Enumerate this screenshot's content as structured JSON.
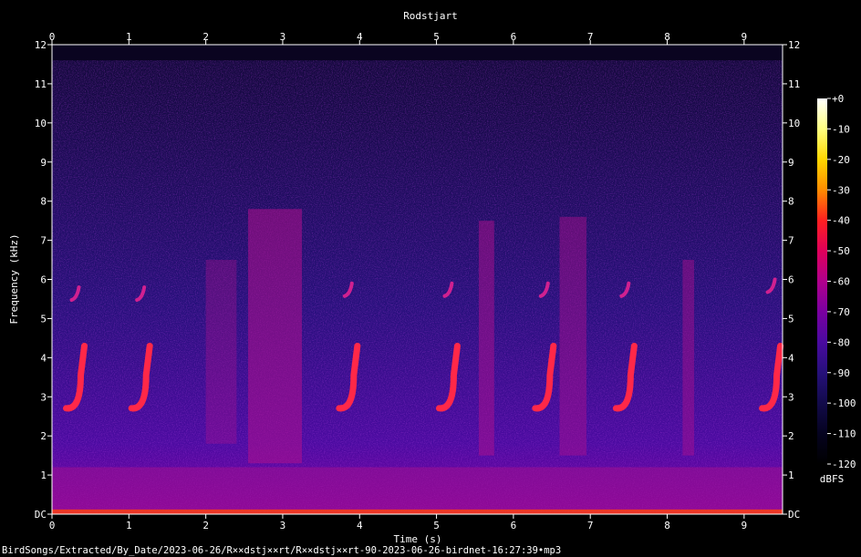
{
  "chart_data": {
    "type": "heatmap",
    "title": "Rodstjart",
    "xlabel": "Time (s)",
    "ylabel": "Frequency (kHz)",
    "xlim": [
      0,
      9.5
    ],
    "ylim": [
      0,
      12
    ],
    "x_ticks": [
      "0",
      "1",
      "2",
      "3",
      "4",
      "5",
      "6",
      "7",
      "8",
      "9"
    ],
    "y_ticks": [
      "DC",
      "1",
      "2",
      "3",
      "4",
      "5",
      "6",
      "7",
      "8",
      "9",
      "10",
      "11",
      "12"
    ],
    "colorbar": {
      "label": "dBFS",
      "range": [
        -120,
        0
      ],
      "ticks": [
        "+0",
        "-10",
        "-20",
        "-30",
        "-40",
        "-50",
        "-60",
        "-70",
        "-80",
        "-90",
        "-100",
        "-110",
        "-120"
      ],
      "colormap": [
        "#ffffff",
        "#ffff80",
        "#ffd700",
        "#ff8c00",
        "#ff2020",
        "#e0005a",
        "#b0008c",
        "#7a00a0",
        "#4a0aa0",
        "#26107a",
        "#120a4a",
        "#05031f",
        "#000000"
      ]
    },
    "calls": [
      {
        "t": 0.35,
        "f_low": 2.8,
        "f_high": 4.3,
        "upper_f": 5.8
      },
      {
        "t": 1.2,
        "f_low": 2.8,
        "f_high": 4.3,
        "upper_f": 5.8
      },
      {
        "t": 3.9,
        "f_low": 2.8,
        "f_high": 4.3,
        "upper_f": 5.9
      },
      {
        "t": 5.2,
        "f_low": 2.8,
        "f_high": 4.3,
        "upper_f": 5.9
      },
      {
        "t": 6.45,
        "f_low": 2.8,
        "f_high": 4.3,
        "upper_f": 5.9
      },
      {
        "t": 7.5,
        "f_low": 2.8,
        "f_high": 4.3,
        "upper_f": 5.9
      },
      {
        "t": 9.4,
        "f_low": 2.8,
        "f_high": 4.3,
        "upper_f": 6.0
      }
    ],
    "noise_bands": [
      {
        "t0": 2.55,
        "t1": 3.25,
        "f0": 1.3,
        "f1": 7.8,
        "level": 0.55
      },
      {
        "t0": 2.0,
        "t1": 2.4,
        "f0": 1.8,
        "f1": 6.5,
        "level": 0.35
      },
      {
        "t0": 5.55,
        "t1": 5.75,
        "f0": 1.5,
        "f1": 7.5,
        "level": 0.5
      },
      {
        "t0": 6.6,
        "t1": 6.95,
        "f0": 1.5,
        "f1": 7.6,
        "level": 0.45
      },
      {
        "t0": 8.2,
        "t1": 8.35,
        "f0": 1.5,
        "f1": 6.5,
        "level": 0.45
      }
    ]
  },
  "footer": {
    "file_path": "BirdSongs/Extracted/By_Date/2023-06-26/R××dstj××rt/R××dstj××rt-90-2023-06-26-birdnet-16:27:39•mp3"
  }
}
